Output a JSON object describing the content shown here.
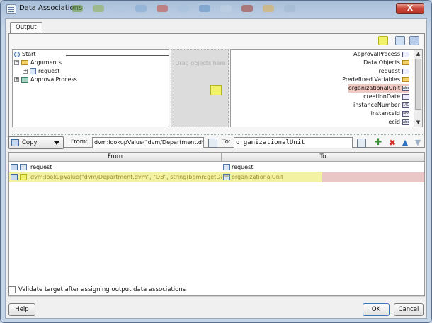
{
  "window": {
    "title": "Data Associations",
    "close_label": "X"
  },
  "tabs": [
    {
      "label": "Output"
    }
  ],
  "left_tree": {
    "nodes": [
      {
        "label": "Start"
      },
      {
        "label": "Arguments"
      },
      {
        "label": "request"
      },
      {
        "label": "ApprovalProcess"
      }
    ]
  },
  "drop_zone": {
    "label": "Drag objects here"
  },
  "right_tree": {
    "nodes": [
      {
        "label": "ApprovalProcess"
      },
      {
        "label": "Data Objects"
      },
      {
        "label": "request"
      },
      {
        "label": "Predefined Variables"
      },
      {
        "label": "organizationalUnit",
        "badge": "abc"
      },
      {
        "label": "creationDate"
      },
      {
        "label": "instanceNumber",
        "badge": "1%"
      },
      {
        "label": "instanceId",
        "badge": "abc"
      },
      {
        "label": "ecid",
        "badge": "abc"
      }
    ]
  },
  "copy_row": {
    "operation": "Copy",
    "from_label": "From:",
    "from_value": "dvm:lookupValue(\"dvm/Department.dvm\",",
    "to_label": "To:",
    "to_value": "organizationalUnit"
  },
  "grid": {
    "columns": {
      "from": "From",
      "to": "To"
    },
    "rows": [
      {
        "from": "request",
        "to": "request"
      },
      {
        "from": "dvm:lookupValue(\"dvm/Department.dvm\", \"DB\", string(bpmn:getDataO...",
        "to": "organizationalUnit",
        "to_badge": "abc"
      }
    ]
  },
  "validate": {
    "label": "Validate target after assigning output data associations",
    "checked": false
  },
  "buttons": {
    "help": "Help",
    "ok": "OK",
    "cancel": "Cancel"
  },
  "colors": {
    "highlight": "#f3f1a2",
    "selection": "#e9c7c7",
    "accent": "#3b73b8"
  }
}
